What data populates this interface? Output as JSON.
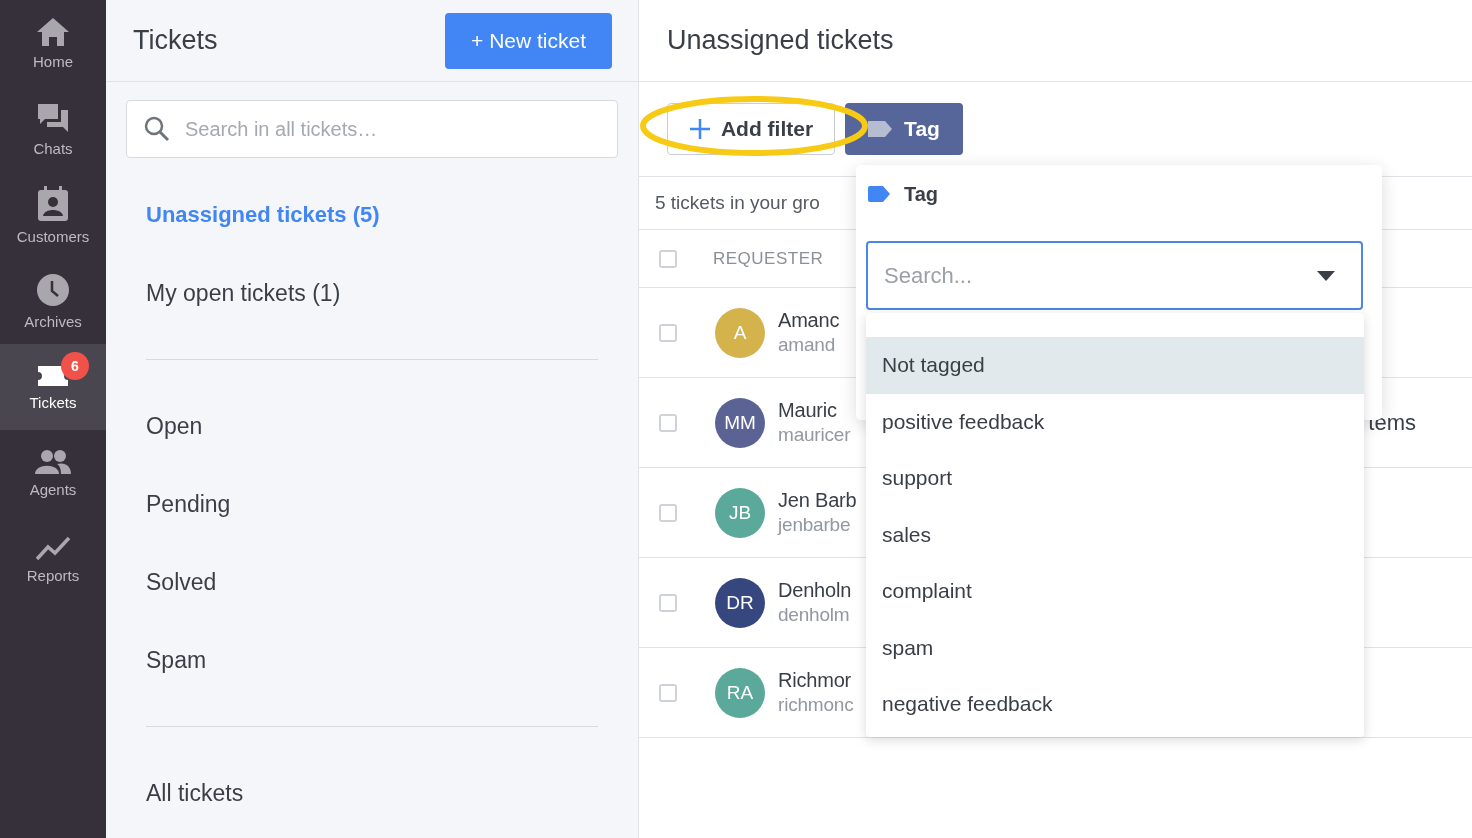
{
  "nav": [
    {
      "kind": "home",
      "label": "Home",
      "selected": false
    },
    {
      "kind": "chats",
      "label": "Chats",
      "selected": false
    },
    {
      "kind": "customers",
      "label": "Customers",
      "selected": false
    },
    {
      "kind": "archives",
      "label": "Archives",
      "selected": false
    },
    {
      "kind": "tickets",
      "label": "Tickets",
      "selected": true,
      "badge": "6"
    },
    {
      "kind": "agents",
      "label": "Agents",
      "selected": false
    },
    {
      "kind": "reports",
      "label": "Reports",
      "selected": false
    }
  ],
  "tickets_panel": {
    "title": "Tickets",
    "new_ticket_button": "+ New ticket",
    "search": {
      "placeholder": "Search in all tickets…"
    },
    "view_groups": [
      {
        "items": [
          {
            "label": "Unassigned tickets (5)",
            "selected": true
          },
          {
            "label": "My open tickets (1)",
            "selected": false
          }
        ]
      },
      {
        "items": [
          {
            "label": "Open",
            "selected": false
          },
          {
            "label": "Pending",
            "selected": false
          },
          {
            "label": "Solved",
            "selected": false
          },
          {
            "label": "Spam",
            "selected": false
          }
        ]
      },
      {
        "items": [
          {
            "label": "All tickets",
            "selected": false
          }
        ]
      }
    ]
  },
  "main": {
    "title": "Unassigned tickets",
    "add_filter_button": "Add filter",
    "tag_filter_button": "Tag",
    "count_text": "5 tickets in your gro",
    "header_checked": false,
    "columns": [
      "REQUESTER"
    ],
    "rows": [
      {
        "initials": "A",
        "color": "#d4b24c",
        "name": "Amanc",
        "email": "amand",
        "checked": false
      },
      {
        "initials": "MM",
        "color": "#5a6394",
        "name": "Mauric",
        "email": "mauricer",
        "subject": "tems",
        "checked": false
      },
      {
        "initials": "JB",
        "color": "#5aa99a",
        "name": "Jen Barb",
        "email": "jenbarbe",
        "checked": false
      },
      {
        "initials": "DR",
        "color": "#36477f",
        "name": "Denholn",
        "email": "denholm",
        "checked": false
      },
      {
        "initials": "RA",
        "color": "#5aa99a",
        "name": "Richmor",
        "email": "richmonc",
        "checked": false
      }
    ]
  },
  "tag_popover": {
    "title": "Tag",
    "search": {
      "placeholder": "Search..."
    },
    "options": [
      {
        "label": "Not tagged",
        "selected": true
      },
      {
        "label": "positive feedback",
        "selected": false
      },
      {
        "label": "support",
        "selected": false
      },
      {
        "label": "sales",
        "selected": false
      },
      {
        "label": "complaint",
        "selected": false
      },
      {
        "label": "spam",
        "selected": false
      },
      {
        "label": "negative feedback",
        "selected": false
      }
    ]
  }
}
